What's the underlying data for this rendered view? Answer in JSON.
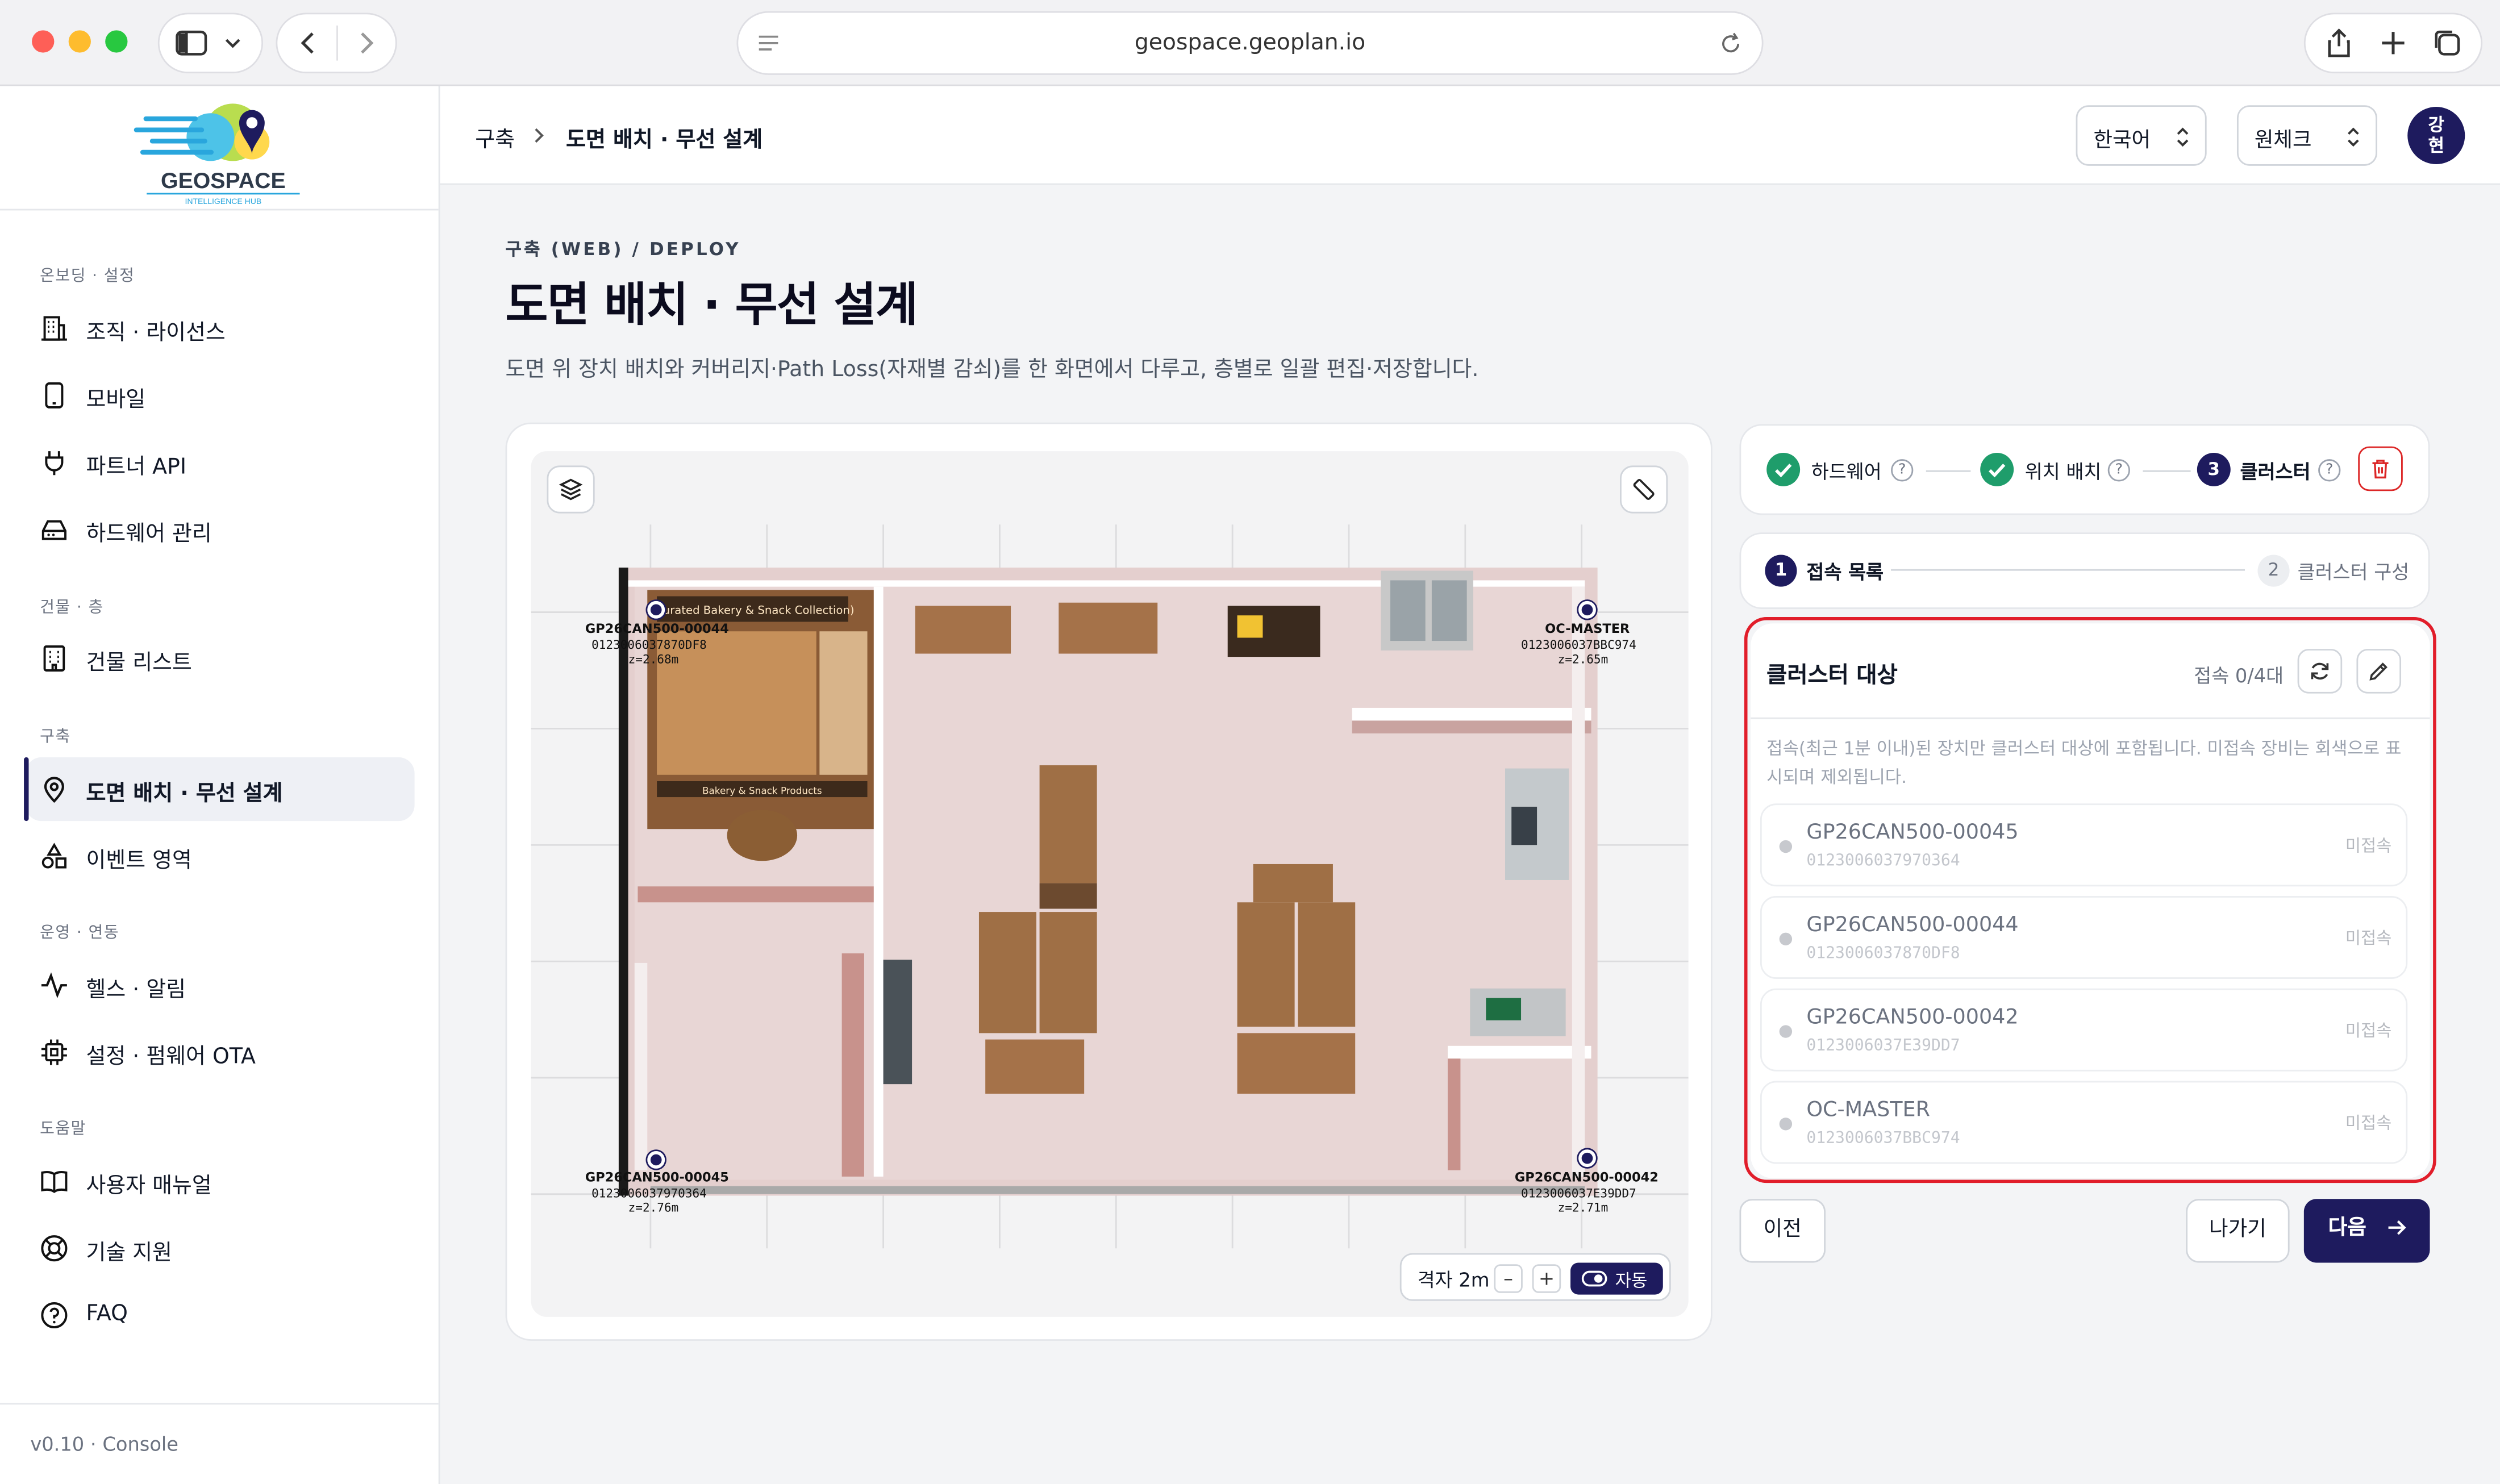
{
  "browser": {
    "url": "geospace.geoplan.io"
  },
  "logo": {
    "name": "GEOSPACE",
    "tagline": "INTELLIGENCE HUB"
  },
  "sidebar": {
    "sections": [
      {
        "label": "온보딩 · 설정",
        "items": [
          {
            "label": "조직 · 라이선스"
          },
          {
            "label": "모바일"
          },
          {
            "label": "파트너 API"
          },
          {
            "label": "하드웨어 관리"
          }
        ]
      },
      {
        "label": "건물 · 층",
        "items": [
          {
            "label": "건물 리스트"
          }
        ]
      },
      {
        "label": "구축",
        "items": [
          {
            "label": "도면 배치 · 무선 설계"
          },
          {
            "label": "이벤트 영역"
          }
        ]
      },
      {
        "label": "운영 · 연동",
        "items": [
          {
            "label": "헬스 · 알림"
          },
          {
            "label": "설정 · 펌웨어 OTA"
          }
        ]
      },
      {
        "label": "도움말",
        "items": [
          {
            "label": "사용자 매뉴얼"
          },
          {
            "label": "기술 지원"
          },
          {
            "label": "FAQ"
          }
        ]
      }
    ],
    "active_item": "도면 배치 · 무선 설계",
    "version": "v0.10 · Console"
  },
  "header": {
    "breadcrumb": [
      "구축",
      "도면 배치 · 무선 설계"
    ],
    "language": "한국어",
    "organization": "원체크",
    "avatar": "강\n현"
  },
  "page": {
    "eyebrow": "구축 (WEB) / DEPLOY",
    "title": "도면 배치 · 무선 설계",
    "description": "도면 위 장치 배치와 커버리지·Path Loss(자재별 감쇠)를 한 화면에서 다루고, 층별로 일괄 편집·저장합니다."
  },
  "map": {
    "store_signs": {
      "bakery_top": "(Curated Bakery & Snack Collection)",
      "bakery_bottom": "Bakery & Snack Products"
    },
    "devices": [
      {
        "name": "GP26CAN500-00044",
        "id": "0123006037870DF8",
        "z": "z=2.68m"
      },
      {
        "name": "OC-MASTER",
        "id": "0123006037BBC974",
        "z": "z=2.65m"
      },
      {
        "name": "GP26CAN500-00045",
        "id": "0123006037970364",
        "z": "z=2.76m"
      },
      {
        "name": "GP26CAN500-00042",
        "id": "0123006037E39DD7",
        "z": "z=2.71m"
      }
    ],
    "grid_label": "격자 2m",
    "minus": "–",
    "plus": "+",
    "auto_label": "자동"
  },
  "stepper": {
    "steps": [
      {
        "label": "하드웨어",
        "status": "done"
      },
      {
        "label": "위치 배치",
        "status": "done"
      },
      {
        "label": "클러스터",
        "status": "current",
        "number": "3"
      }
    ],
    "help": "?"
  },
  "substeps": [
    {
      "number": "1",
      "label": "접속 목록",
      "active": true
    },
    {
      "number": "2",
      "label": "클러스터 구성",
      "active": false
    }
  ],
  "cluster": {
    "title": "클러스터 대상",
    "count": "접속 0/4대",
    "note": "접속(최근 1분 이내)된 장치만 클러스터 대상에 포함됩니다. 미접속 장비는 회색으로 표시되며 제외됩니다.",
    "devices": [
      {
        "name": "GP26CAN500-00045",
        "id": "0123006037970364",
        "status": "미접속"
      },
      {
        "name": "GP26CAN500-00044",
        "id": "0123006037870DF8",
        "status": "미접속"
      },
      {
        "name": "GP26CAN500-00042",
        "id": "0123006037E39DD7",
        "status": "미접속"
      },
      {
        "name": "OC-MASTER",
        "id": "0123006037BBC974",
        "status": "미접속"
      }
    ]
  },
  "actions": {
    "prev": "이전",
    "exit": "나가기",
    "next": "다음"
  },
  "colors": {
    "primary": "#1e1b5e",
    "success": "#1f9d6b",
    "danger": "#e11d2a",
    "floor": "#e6d3d2"
  }
}
